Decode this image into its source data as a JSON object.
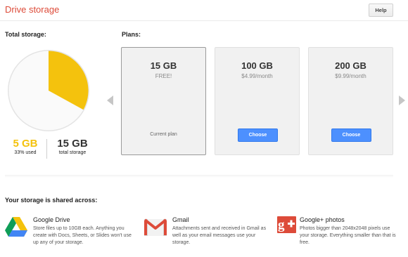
{
  "header": {
    "title": "Drive storage",
    "help_label": "Help"
  },
  "total_storage": {
    "label": "Total storage:",
    "used_value": "5 GB",
    "used_caption": "33% used",
    "used_fraction": 0.33,
    "total_value": "15 GB",
    "total_caption": "total storage"
  },
  "plans": {
    "label": "Plans:",
    "items": [
      {
        "size": "15 GB",
        "price": "FREE!",
        "status": "Current plan"
      },
      {
        "size": "100 GB",
        "price": "$4.99/month",
        "action": "Choose"
      },
      {
        "size": "200 GB",
        "price": "$9.99/month",
        "action": "Choose"
      }
    ]
  },
  "shared": {
    "label": "Your storage is shared across:",
    "services": [
      {
        "name": "Google Drive",
        "icon": "google-drive-icon",
        "description": "Store files up to 10GB each. Anything you create with Docs, Sheets, or Slides won't use up any of your storage."
      },
      {
        "name": "Gmail",
        "icon": "gmail-icon",
        "description": "Attachments sent and received in Gmail as well as your email messages use your storage."
      },
      {
        "name": "Google+ photos",
        "icon": "google-plus-icon",
        "description": "Photos bigger than 2048x2048 pixels use your storage. Everything smaller than that is free."
      }
    ]
  },
  "colors": {
    "title_red": "#dd4b39",
    "used_yellow": "#f4c20d",
    "button_blue": "#4d90fe",
    "gplus_red": "#dd4b39"
  }
}
